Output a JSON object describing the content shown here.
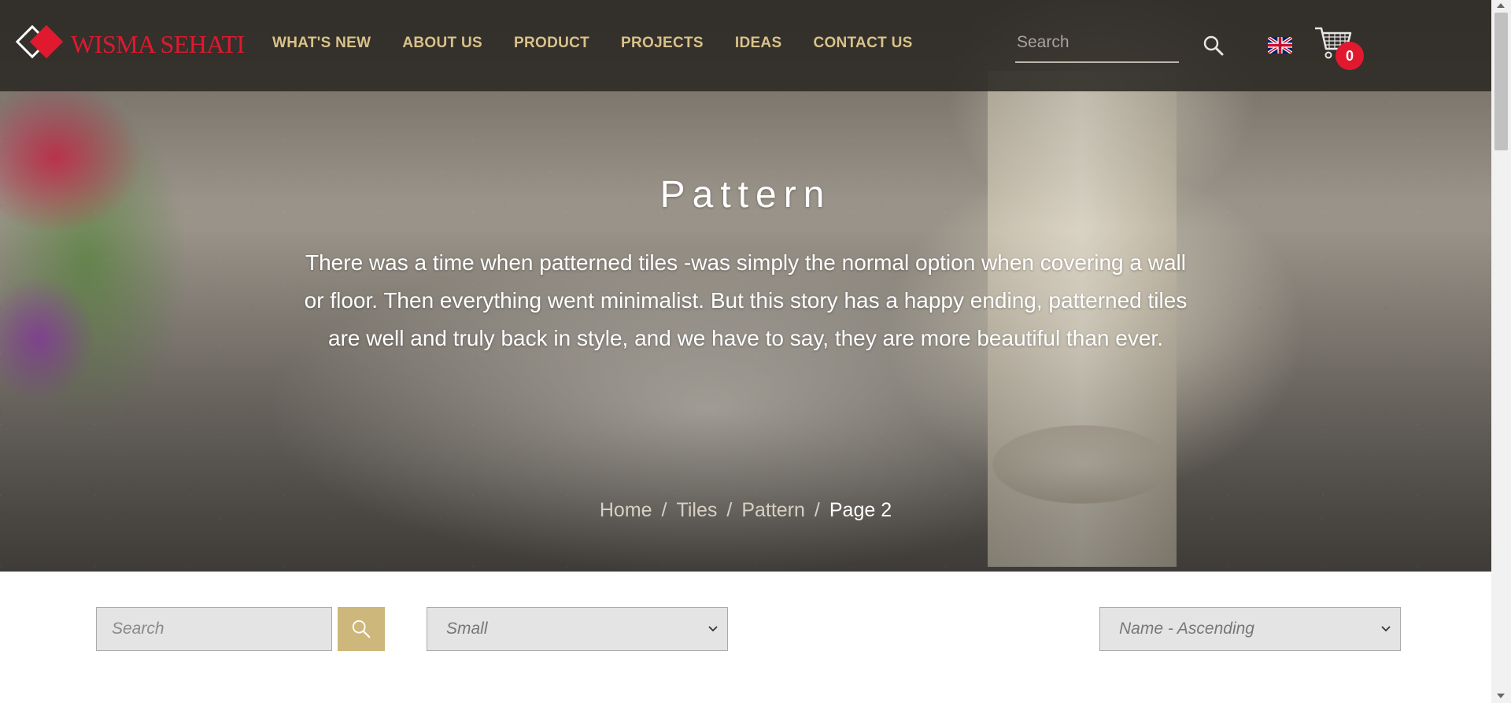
{
  "brand": {
    "name": "WISMA SEHATI"
  },
  "nav": {
    "items": [
      {
        "label": "WHAT'S NEW"
      },
      {
        "label": "ABOUT US"
      },
      {
        "label": "PRODUCT"
      },
      {
        "label": "PROJECTS"
      },
      {
        "label": "IDEAS"
      },
      {
        "label": "CONTACT US"
      }
    ]
  },
  "header": {
    "search_placeholder": "Search",
    "language_icon": "uk-flag-icon",
    "cart_icon": "cart-icon",
    "cart_count": "0"
  },
  "hero": {
    "title": "Pattern",
    "description": "There was a time when patterned tiles -was simply the normal option when covering a wall or floor. Then everything went minimalist. But this story has a happy ending, patterned tiles are well and truly back in style, and we have to say, they are more beautiful than ever."
  },
  "breadcrumb": {
    "items": [
      "Home",
      "Tiles",
      "Pattern"
    ],
    "current": "Page 2"
  },
  "filters": {
    "search_placeholder": "Search",
    "size_selected": "Small",
    "sort_selected": "Name - Ascending"
  },
  "colors": {
    "brand_red": "#e0192f",
    "nav_gold": "#d9c28a",
    "button_gold": "#cdb77a"
  }
}
